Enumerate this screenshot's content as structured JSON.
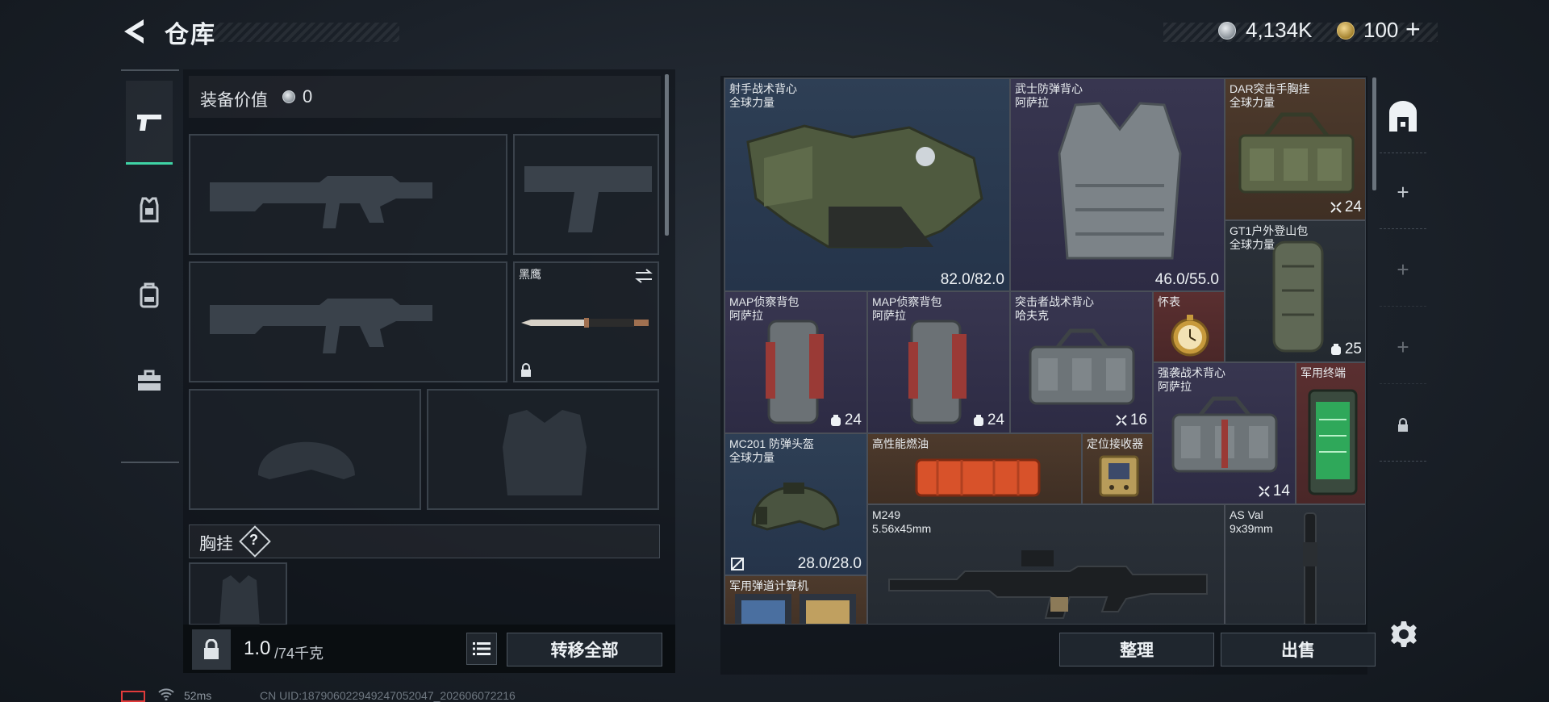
{
  "header": {
    "title": "仓库",
    "silver_amount": "4,134K",
    "gold_amount": "100",
    "add_label": "+"
  },
  "equipment": {
    "value_label": "装备价值",
    "value": "0",
    "melee_name": "黑鹰",
    "chest_label": "胸挂",
    "chest_help": "?"
  },
  "bottom": {
    "weight_current": "1.0",
    "weight_rest": "/74千克",
    "transfer_all": "转移全部",
    "sort": "整理",
    "sell": "出售"
  },
  "warehouse": {
    "items": [
      {
        "name": "射手战术背心\n全球力量",
        "value": "82.0/82.0"
      },
      {
        "name": "武士防弹背心\n阿萨拉",
        "value": "46.0/55.0"
      },
      {
        "name": "DAR突击手胸挂\n全球力量",
        "count": "24"
      },
      {
        "name": "GT1户外登山包\n全球力量",
        "count": "25"
      },
      {
        "name": "MAP侦察背包\n阿萨拉",
        "count": "24"
      },
      {
        "name": "MAP侦察背包\n阿萨拉",
        "count": "24"
      },
      {
        "name": "突击者战术背心\n哈夫克",
        "count": "16"
      },
      {
        "name": "怀表"
      },
      {
        "name": "强袭战术背心\n阿萨拉",
        "count": "14"
      },
      {
        "name": "军用终端"
      },
      {
        "name": "MC201 防弹头盔\n全球力量",
        "value": "28.0/28.0"
      },
      {
        "name": "高性能燃油"
      },
      {
        "name": "定位接收器"
      },
      {
        "name": "M249\n5.56x45mm"
      },
      {
        "name": "AS Val\n9x39mm"
      },
      {
        "name": "军用弹道计算机"
      }
    ]
  },
  "footer": {
    "ping": "52ms",
    "uid": "CN UID:187906022949247052047_202606072216"
  },
  "colors": {
    "accent": "#3fd3a5",
    "blue_rarity": "#2e3f55",
    "purple_rarity": "#383650",
    "gold_rarity": "#4d3a2c",
    "red_rarity": "#5a2f30"
  }
}
